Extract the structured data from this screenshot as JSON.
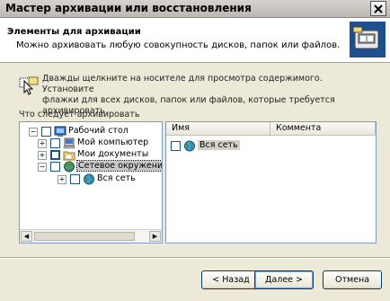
{
  "window": {
    "title": "Мастер архивации или восстановления"
  },
  "header": {
    "title": "Элементы для архивации",
    "subtitle": "Можно архивовать любую совокупность дисков, папок или файлов."
  },
  "hint": {
    "line1": "Дважды щелкните на носителе для просмотра содержимого. Установите",
    "line2": "флажки для всех дисков, папок или файлов, которые требуется архивировать"
  },
  "tree": {
    "label": "Что следует архивировать",
    "items": [
      {
        "label": "Рабочий стол",
        "icon": "desktop-icon",
        "expander": "−"
      },
      {
        "label": "Мой компьютер",
        "icon": "computer-icon",
        "expander": "+"
      },
      {
        "label": "Мои документы",
        "icon": "folder-icon",
        "expander": "+"
      },
      {
        "label": "Сетевое окружение",
        "icon": "network-icon",
        "expander": "−"
      },
      {
        "label": "Вся сеть",
        "icon": "globe-icon",
        "expander": "+"
      }
    ]
  },
  "list": {
    "columns": [
      "Имя",
      "Коммента"
    ],
    "rows": [
      {
        "label": "Вся сеть",
        "icon": "globe-icon"
      }
    ]
  },
  "buttons": {
    "back": "< Назад",
    "next": "Далее >",
    "cancel": "Отмена"
  }
}
